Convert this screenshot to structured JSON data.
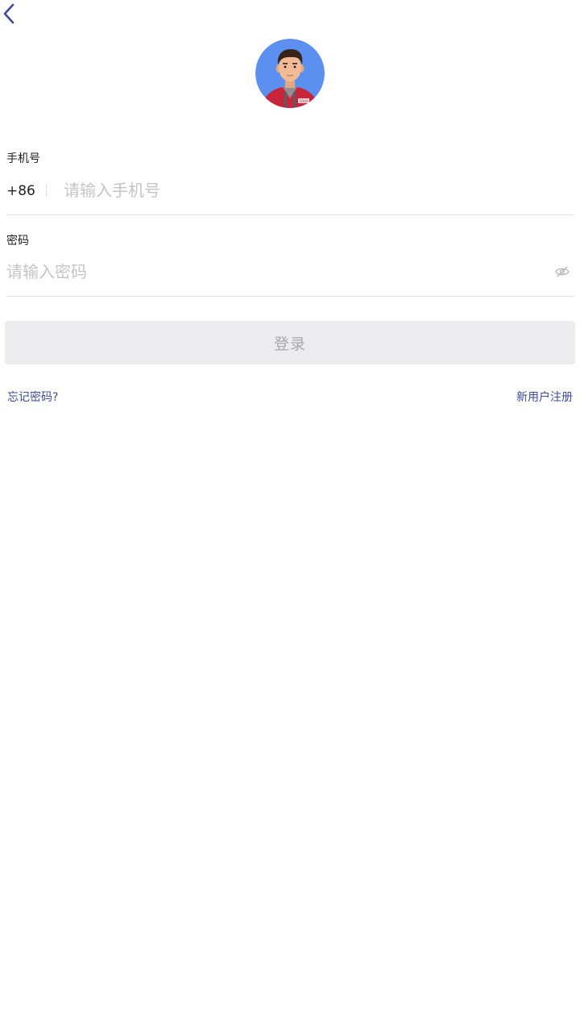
{
  "header": {
    "back_icon": "chevron-left-icon",
    "accent_color": "#3d4a9e"
  },
  "avatar": {
    "icon": "user-avatar-illustration",
    "background_color": "#5b8ff0",
    "badge_text": "2000"
  },
  "phone": {
    "label": "手机号",
    "country_code": "+86",
    "placeholder": "请输入手机号",
    "value": ""
  },
  "password": {
    "label": "密码",
    "placeholder": "请输入密码",
    "value": "",
    "toggle_icon": "eye-hidden-icon"
  },
  "login": {
    "label": "登录",
    "background_color": "#ececef",
    "text_color": "#a8a8ac"
  },
  "links": {
    "forgot_password": "忘记密码?",
    "register": "新用户注册",
    "color": "#3d4a9e"
  }
}
